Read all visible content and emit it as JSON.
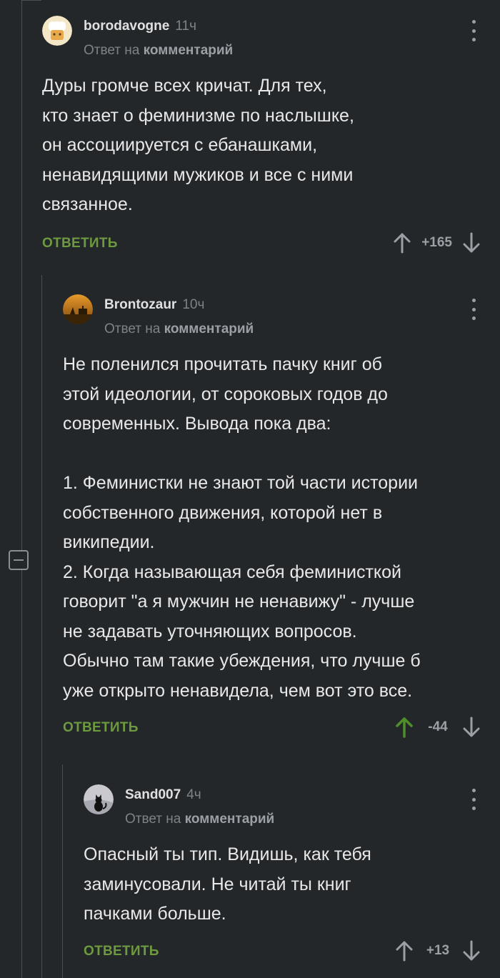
{
  "colors": {
    "background": "#23272a",
    "reply_green": "#6e9a3f",
    "upvoted_green": "#4f8f2a",
    "muted": "#7d8388"
  },
  "comments": [
    {
      "username": "borodavogne",
      "time": "11ч",
      "reply_prefix": "Ответ на",
      "reply_link": "комментарий",
      "text": "Дуры громче всех кричат. Для тех,\nкто знает о феминизме по наслышке,\nон ассоциируется с ебанашками,\nненавидящими мужиков и все с ними\nсвязанное.",
      "reply_label": "ОТВЕТИТЬ",
      "score": "+165",
      "upvoted": false
    },
    {
      "username": "Brontozaur",
      "time": "10ч",
      "reply_prefix": "Ответ на",
      "reply_link": "комментарий",
      "text": "Не поленился прочитать пачку книг об\nэтой идеологии, от сороковых годов до\nсовременных. Вывода пока два:\n\n1. Феминистки не знают той части истории\nсобственного движения, которой нет в\nвикипедии.\n2. Когда называющая себя феминисткой\nговорит \"а я мужчин не ненавижу\" - лучше\nне задавать уточняющих вопросов.\nОбычно там такие убеждения, что лучше б\nуже открыто ненавидела, чем вот это все.",
      "reply_label": "ОТВЕТИТЬ",
      "score": "-44",
      "upvoted": true
    },
    {
      "username": "Sand007",
      "time": "4ч",
      "reply_prefix": "Ответ на",
      "reply_link": "комментарий",
      "text": "Опасный ты тип. Видишь, как тебя\nзаминусовали. Не читай ты книг\nпачками больше.",
      "reply_label": "ОТВЕТИТЬ",
      "score": "+13",
      "upvoted": false
    }
  ]
}
